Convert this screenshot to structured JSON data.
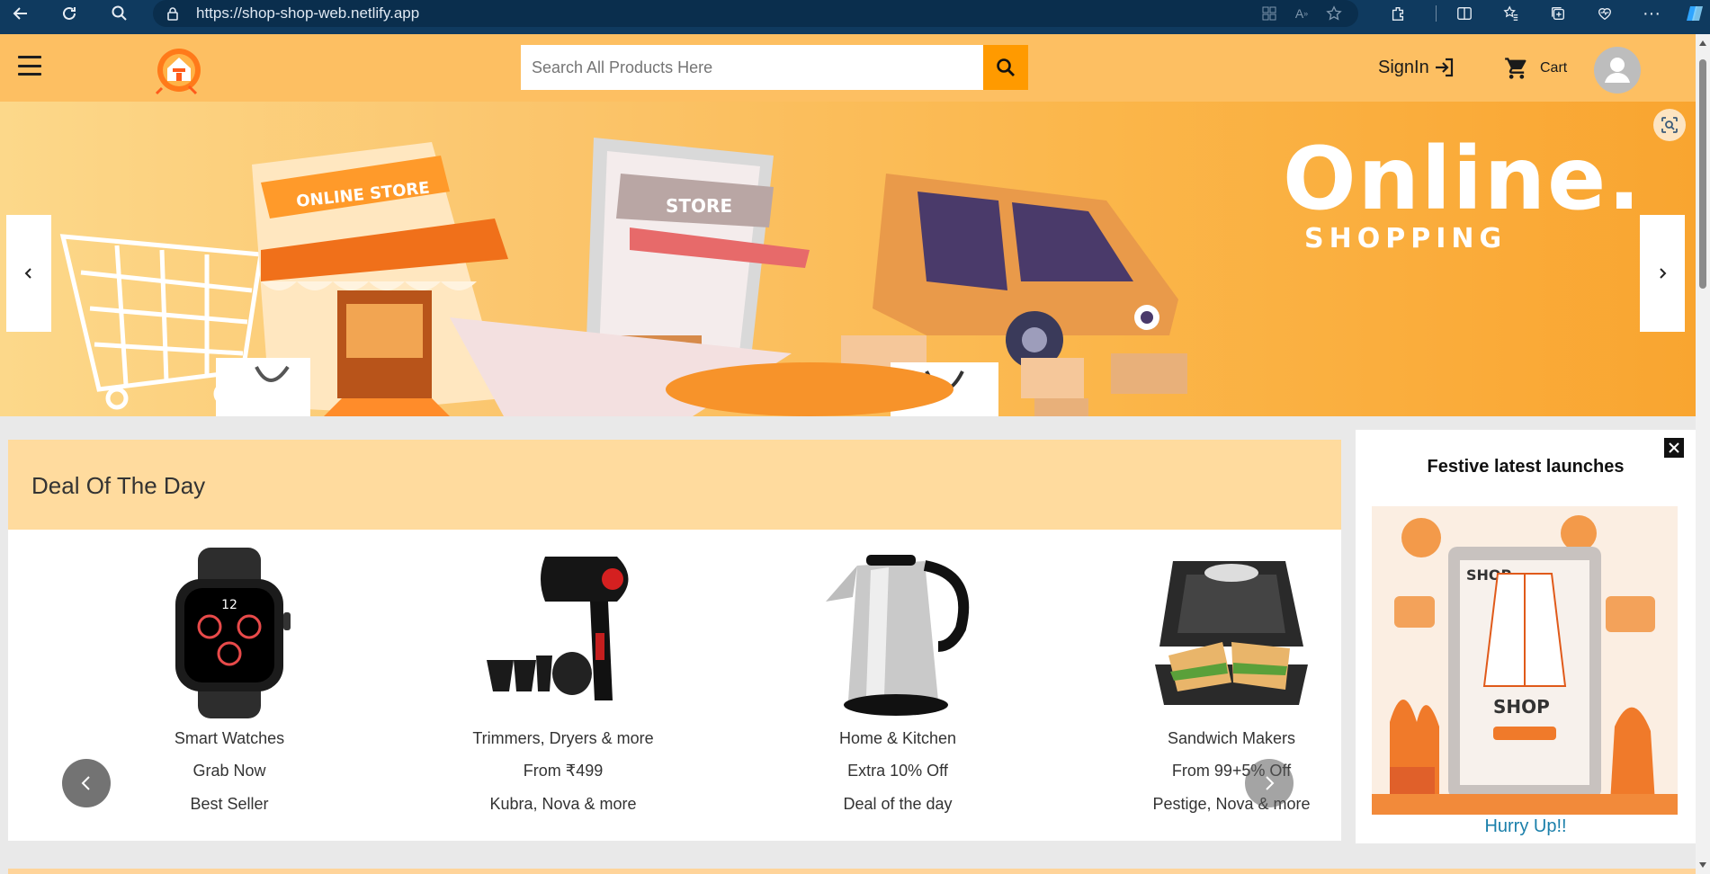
{
  "browser": {
    "url": "https://shop-shop-web.netlify.app"
  },
  "header": {
    "search_placeholder": "Search All Products Here",
    "signin_label": "SignIn",
    "cart_label": "Cart"
  },
  "hero": {
    "title": "Online.",
    "subtitle": "SHOPPING"
  },
  "deal": {
    "title": "Deal Of The Day",
    "products": [
      {
        "name": "Smart Watches",
        "offer": "Grab Now",
        "brand": "Best Seller"
      },
      {
        "name": "Trimmers, Dryers & more",
        "offer": "From ₹499",
        "brand": "Kubra, Nova & more"
      },
      {
        "name": "Home & Kitchen",
        "offer": "Extra 10% Off",
        "brand": "Deal of the day"
      },
      {
        "name": "Sandwich Makers",
        "offer": "From 99+5% Off",
        "brand": "Pestige, Nova & more"
      }
    ]
  },
  "side_panel": {
    "title": "Festive latest launches",
    "cta": "Hurry Up!!"
  },
  "colors": {
    "header_bg": "#fdbf62",
    "search_button": "#ff9a00",
    "deal_header_bg": "#ffdb9e",
    "browser_bar": "#0f3a5f",
    "cta_link": "#1a7faa"
  }
}
